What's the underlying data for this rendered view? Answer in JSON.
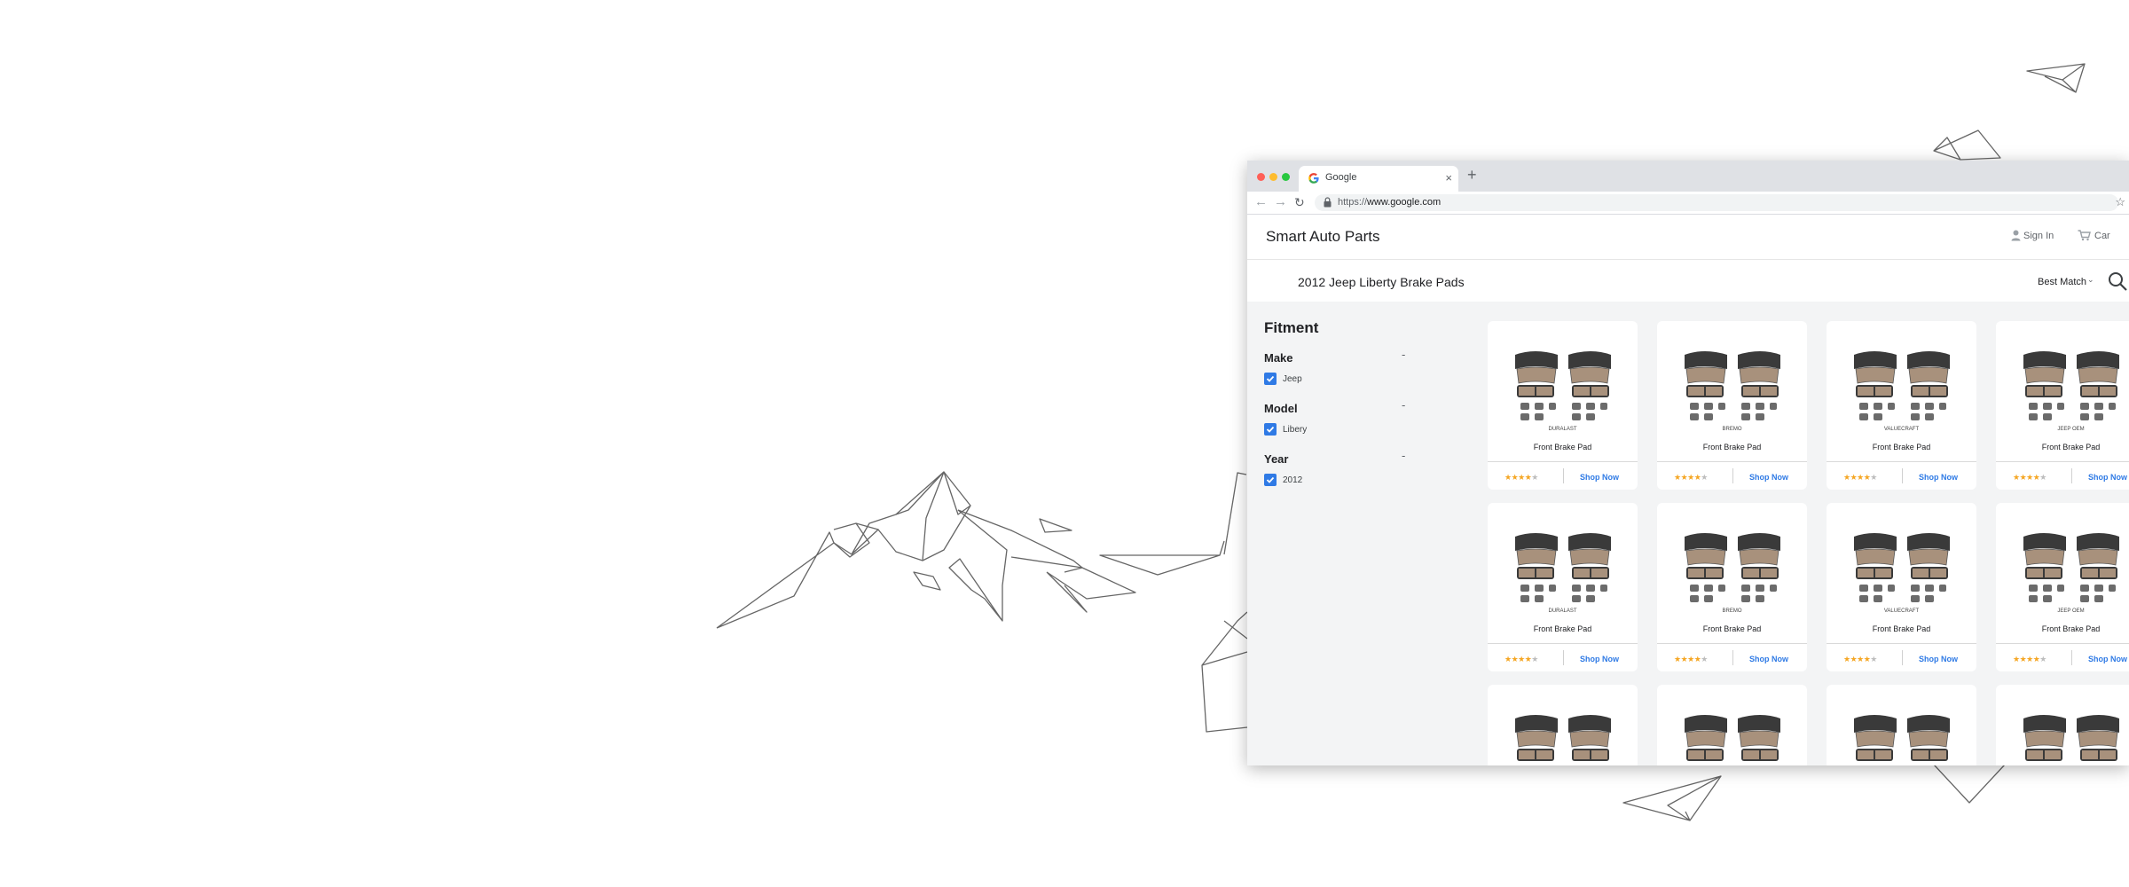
{
  "browser": {
    "tab_title": "Google",
    "new_tab_label": "+",
    "close_label": "×",
    "url_scheme": "https://",
    "url_host": "www.google.com"
  },
  "site": {
    "brand": "Smart Auto Parts",
    "sign_in": "Sign In",
    "cart": "Car"
  },
  "search": {
    "query": "2012 Jeep Liberty Brake Pads",
    "sort": "Best Match"
  },
  "sidebar": {
    "title": "Fitment",
    "facets": [
      {
        "label": "Make",
        "collapse": "-",
        "option": "Jeep",
        "checked": true
      },
      {
        "label": "Model",
        "collapse": "-",
        "option": "Libery",
        "checked": true
      },
      {
        "label": "Year",
        "collapse": "-",
        "option": "2012",
        "checked": true
      }
    ]
  },
  "products": [
    {
      "brand": "DURALAST",
      "name": "Front Brake Pad",
      "rating": 4,
      "cta": "Shop Now"
    },
    {
      "brand": "BREMO",
      "name": "Front Brake Pad",
      "rating": 4,
      "cta": "Shop Now"
    },
    {
      "brand": "VALUECRAFT",
      "name": "Front Brake Pad",
      "rating": 4,
      "cta": "Shop Now"
    },
    {
      "brand": "JEEP OEM",
      "name": "Front Brake Pad",
      "rating": 4,
      "cta": "Shop Now"
    },
    {
      "brand": "DURALAST",
      "name": "Front Brake Pad",
      "rating": 4,
      "cta": "Shop Now"
    },
    {
      "brand": "BREMO",
      "name": "Front Brake Pad",
      "rating": 4,
      "cta": "Shop Now"
    },
    {
      "brand": "VALUECRAFT",
      "name": "Front Brake Pad",
      "rating": 4,
      "cta": "Shop Now"
    },
    {
      "brand": "JEEP OEM",
      "name": "Front Brake Pad",
      "rating": 4,
      "cta": "Shop Now"
    },
    {
      "brand": "",
      "name": "",
      "rating": 0,
      "cta": ""
    },
    {
      "brand": "",
      "name": "",
      "rating": 0,
      "cta": ""
    },
    {
      "brand": "",
      "name": "",
      "rating": 0,
      "cta": ""
    },
    {
      "brand": "",
      "name": "",
      "rating": 0,
      "cta": ""
    }
  ],
  "colors": {
    "accent": "#2f7ae5",
    "star": "#f5a623",
    "pad_dark": "#3a3a3a",
    "pad_friction": "#a8917c"
  }
}
